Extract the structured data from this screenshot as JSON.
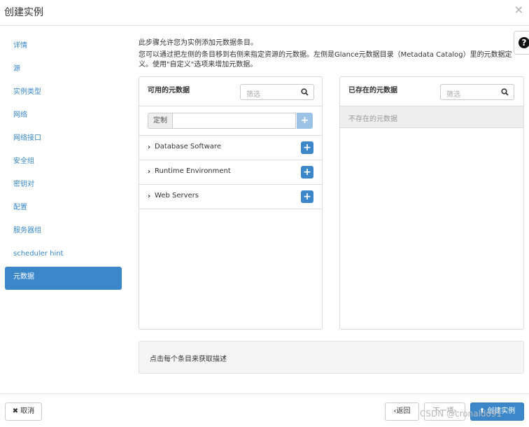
{
  "header": {
    "title": "创建实例",
    "close": "×"
  },
  "help": {
    "glyph": "?"
  },
  "nav": {
    "items": [
      {
        "label": "详情"
      },
      {
        "label": "源"
      },
      {
        "label": "实例类型"
      },
      {
        "label": "网络"
      },
      {
        "label": "网络接口"
      },
      {
        "label": "安全组"
      },
      {
        "label": "密钥对"
      },
      {
        "label": "配置"
      },
      {
        "label": "服务器组"
      },
      {
        "label": "scheduler hint"
      },
      {
        "label": "元数据",
        "active": true
      }
    ]
  },
  "intro": {
    "line1": "此步骤允许您为实例添加元数据条目。",
    "line2": "您可以通过把左侧的条目移到右侧来指定资源的元数据。左侧是Glance元数据目录（Metadata Catalog）里的元数据定义。使用\"自定义\"选项来增加元数据。"
  },
  "available": {
    "title": "可用的元数据",
    "filter_placeholder": "筛选",
    "custom_label": "定制",
    "custom_value": "",
    "add_glyph": "+",
    "items": [
      {
        "name": "Database Software"
      },
      {
        "name": "Runtime Environment"
      },
      {
        "name": "Web Servers"
      }
    ]
  },
  "existing": {
    "title": "已存在的元数据",
    "filter_placeholder": "筛选",
    "empty_text": "不存在的元数据"
  },
  "description": {
    "text": "点击每个条目来获取描述"
  },
  "footer": {
    "cancel_label": "取消",
    "back_label": "‹返回",
    "next_label": "下一项›",
    "create_label": "创建实例"
  },
  "watermark": "CSDN @cronaldo91",
  "colors": {
    "accent": "#3b87c9",
    "link": "#3a87c7"
  }
}
